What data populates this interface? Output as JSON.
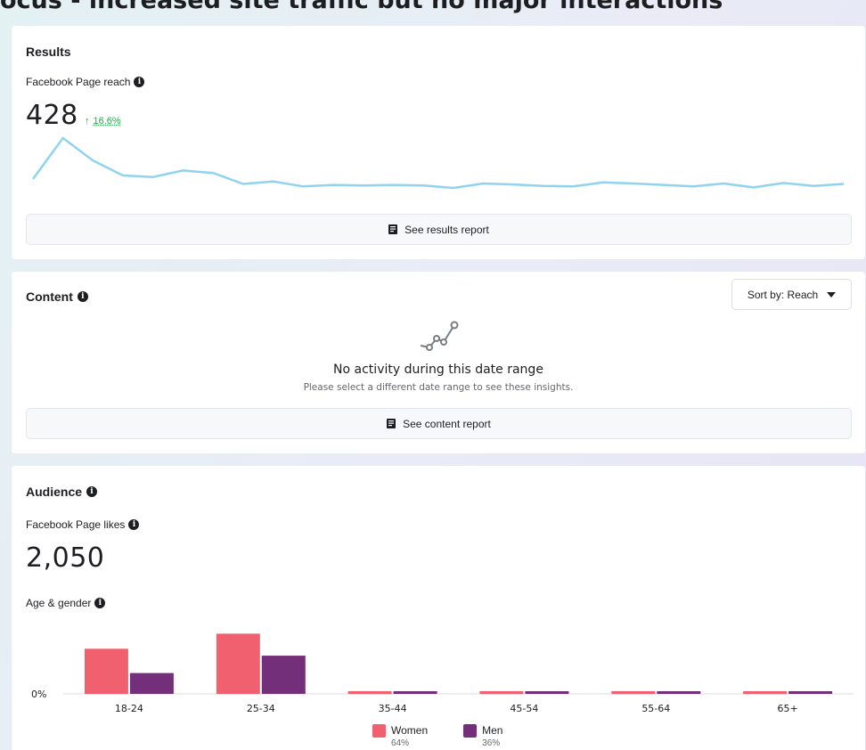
{
  "caption": "ocus - increased site traffic but no major interactions",
  "results": {
    "title": "Results",
    "metric_label": "Facebook Page reach",
    "value": "428",
    "delta_arrow": "↑",
    "delta": "16.6%",
    "report_button": "See results report",
    "line_color": "#8fd3f0",
    "chart_data": {
      "type": "line",
      "values": [
        428,
        510,
        465,
        435,
        432,
        445,
        440,
        418,
        423,
        413,
        416,
        415,
        416,
        415,
        410,
        419,
        417,
        414,
        413,
        421,
        419,
        416,
        413,
        419,
        411,
        420,
        414,
        418
      ]
    }
  },
  "content": {
    "title": "Content",
    "sort_label": "Sort by: Reach",
    "empty_title": "No activity during this date range",
    "empty_subtitle": "Please select a different date range to see these insights.",
    "report_button": "See content report"
  },
  "audience": {
    "title": "Audience",
    "metric_label": "Facebook Page likes",
    "value": "2,050",
    "age_gender_label": "Age & gender",
    "y_tick": "0%",
    "colors": {
      "women": "#f0606f",
      "men": "#742f7a"
    },
    "chart_data": {
      "type": "bar",
      "categories": [
        "18-24",
        "25-34",
        "35-44",
        "45-54",
        "55-64",
        "65+"
      ],
      "series": [
        {
          "name": "Women",
          "values": [
            19.5,
            26,
            0.6,
            0.6,
            0.6,
            0.6
          ]
        },
        {
          "name": "Men",
          "values": [
            9,
            16.5,
            0.6,
            0.6,
            0.6,
            0.6
          ]
        }
      ]
    },
    "legend": [
      {
        "label": "Women",
        "pct": "64%"
      },
      {
        "label": "Men",
        "pct": "36%"
      }
    ]
  }
}
